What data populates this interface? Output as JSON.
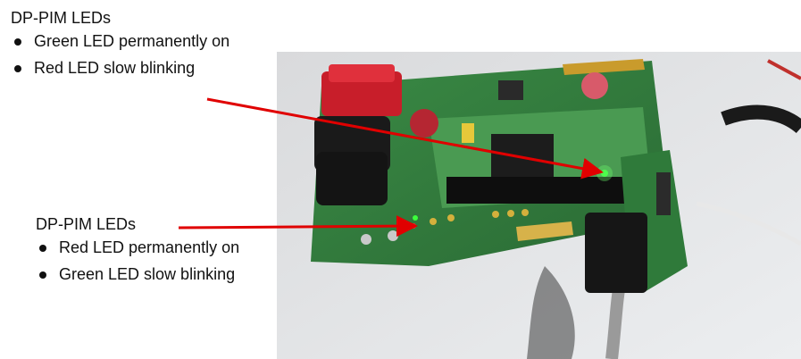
{
  "top_label": {
    "title": "DP-PIM LEDs",
    "items": [
      "Green LED permanently on",
      "Red LED slow blinking"
    ]
  },
  "bottom_label": {
    "title": "DP-PIM LEDs",
    "items": [
      "Red LED permanently on",
      "Green LED slow blinking"
    ]
  },
  "colors": {
    "arrow": "#e00000",
    "pcb_green": "#2f7a3a",
    "background": "#ffffff"
  }
}
